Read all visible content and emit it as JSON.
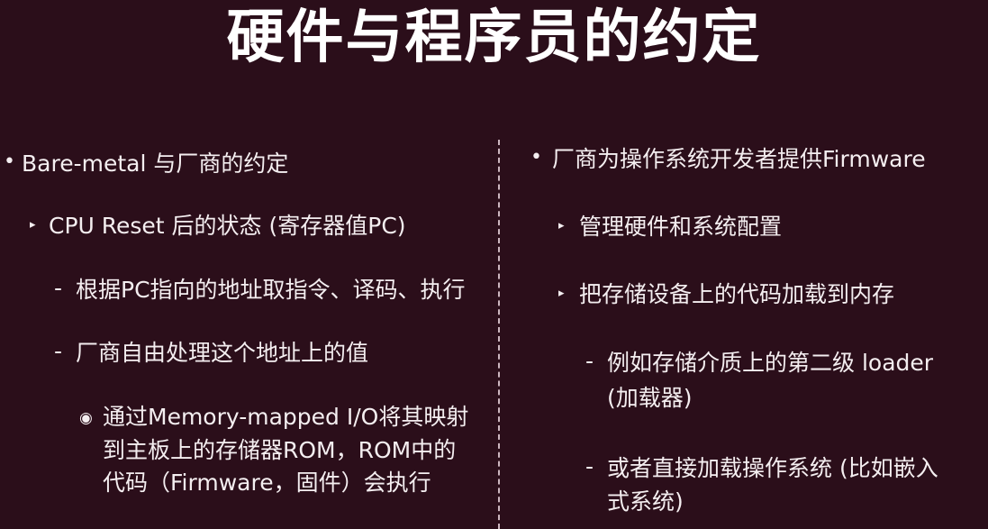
{
  "slide": {
    "title": "硬件与程序员的约定"
  },
  "left": {
    "bullet1": "Bare-metal 与厂商的约定",
    "sub1": "CPU Reset 后的状态 (寄存器值PC)",
    "item1": "根据PC指向的地址取指令、译码、执行",
    "item2": "厂商自由处理这个地址上的值",
    "detail_line1": "通过Memory-mapped I/O将其映射",
    "detail_line2": "到主板上的存储器ROM，ROM中的",
    "detail_line3": "代码（Firmware，固件）会执行"
  },
  "right": {
    "bullet1": "厂商为操作系统开发者提供Firmware",
    "sub1": "管理硬件和系统配置",
    "sub2": "把存储设备上的代码加载到内存",
    "item1_line1": "例如存储介质上的第二级 loader",
    "item1_line2": "(加载器)",
    "item2_line1": "或者直接加载操作系统 (比如嵌入",
    "item2_line2": "式系统)"
  },
  "markers": {
    "bullet": "•",
    "triangle": "▸",
    "dash": "-",
    "circle": "◉"
  },
  "colors": {
    "background": "#2b0e1a",
    "text": "#f4eef0"
  }
}
